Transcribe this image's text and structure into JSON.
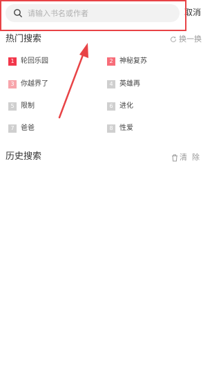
{
  "search": {
    "placeholder": "请输入书名或作者"
  },
  "cancel_label": "取消",
  "hot": {
    "title": "热门搜索",
    "refresh_label": "换一换",
    "items": [
      {
        "rank": "1",
        "label": "轮回乐园",
        "badge_color": "#f2374b"
      },
      {
        "rank": "2",
        "label": "神秘复苏",
        "badge_color": "#f76d79"
      },
      {
        "rank": "3",
        "label": "你越界了",
        "badge_color": "#f7a5ab"
      },
      {
        "rank": "4",
        "label": "英雄再",
        "badge_color": "#cfcfcf"
      },
      {
        "rank": "5",
        "label": "限制",
        "badge_color": "#cfcfcf"
      },
      {
        "rank": "6",
        "label": "进化",
        "badge_color": "#cfcfcf"
      },
      {
        "rank": "7",
        "label": "爸爸",
        "badge_color": "#cfcfcf"
      },
      {
        "rank": "8",
        "label": "性爱",
        "badge_color": "#cfcfcf"
      }
    ]
  },
  "history": {
    "title": "历史搜索",
    "clear_label": "清  除"
  },
  "colors": {
    "annotation": "#e84346",
    "muted": "#999999"
  },
  "icons": {
    "search": "search-icon",
    "refresh": "refresh-icon",
    "trash": "trash-icon",
    "arrow": "arrow-annotation"
  }
}
